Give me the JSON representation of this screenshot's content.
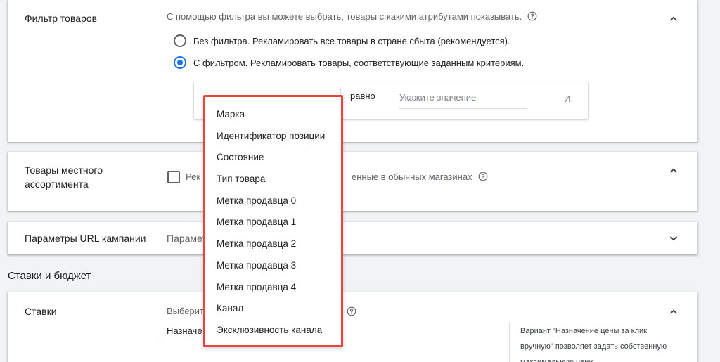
{
  "product_filter": {
    "title": "Фильтр товаров",
    "description": "С помощью фильтра вы можете выбрать, товары с какими атрибутами показывать.",
    "options": [
      {
        "label": "Без фильтра. Рекламировать все товары в стране сбыта (рекомендуется).",
        "selected": false
      },
      {
        "label": "С фильтром. Рекламировать товары, соответствующие заданным критериям.",
        "selected": true
      }
    ],
    "filter_row": {
      "operator": "равно",
      "value_placeholder": "Укажите значение",
      "value": "",
      "and_label": "И"
    }
  },
  "local_products": {
    "title": "Товары местного ассортимента",
    "checkbox_label_start": "Рек",
    "checkbox_label_end": "енные в обычных магазинах",
    "checked": false
  },
  "url_params": {
    "title": "Параметры URL кампании",
    "placeholder_text": "Парамет"
  },
  "bids_budget": {
    "heading": "Ставки и бюджет",
    "bids_title": "Ставки",
    "select_prompt": "Выберит",
    "selected_value": "Назначе",
    "side_note": "Вариант \"Назначение цены за клик вручную\" позволяет задать собственную максимальную цену"
  },
  "attribute_dropdown": {
    "items": [
      "Марка",
      "Идентификатор позиции",
      "Состояние",
      "Тип товара",
      "Метка продавца 0",
      "Метка продавца 1",
      "Метка продавца 2",
      "Метка продавца 3",
      "Метка продавца 4",
      "Канал",
      "Эксклюзивность канала"
    ],
    "highlight_color": "#e8453c"
  },
  "colors": {
    "accent": "#1a73e8",
    "background": "#f1f3f4"
  },
  "icons": {
    "expand_less": "chevron-up-icon",
    "expand_more": "chevron-down-icon",
    "help": "help-circle-icon"
  }
}
